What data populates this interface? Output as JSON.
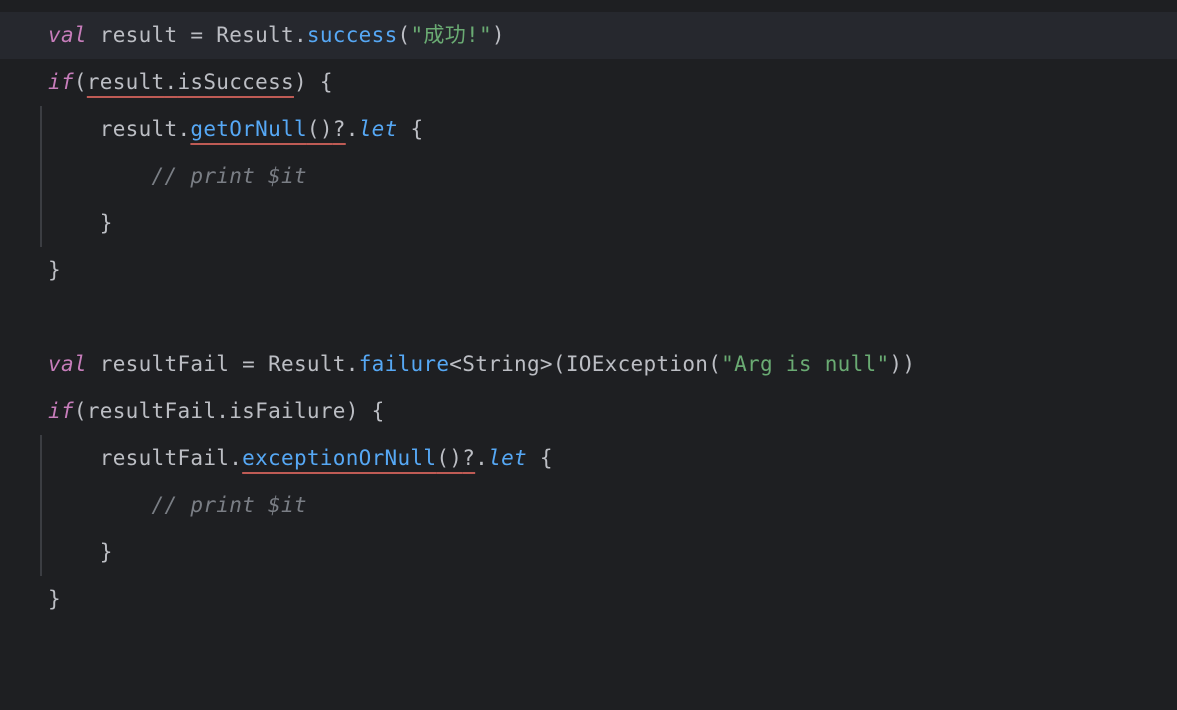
{
  "code": {
    "lines": [
      {
        "highlight": true,
        "indent": 0,
        "segments": [
          {
            "cls": "kw",
            "text": "val"
          },
          {
            "cls": "ident",
            "text": " result "
          },
          {
            "cls": "op",
            "text": "="
          },
          {
            "cls": "ident",
            "text": " Result"
          },
          {
            "cls": "op",
            "text": "."
          },
          {
            "cls": "method",
            "text": "success"
          },
          {
            "cls": "paren",
            "text": "("
          },
          {
            "cls": "str",
            "text": "\"成功!\""
          },
          {
            "cls": "paren",
            "text": ")"
          }
        ]
      },
      {
        "indent": 0,
        "segments": [
          {
            "cls": "kw",
            "text": "if"
          },
          {
            "cls": "paren",
            "text": "("
          },
          {
            "cls": "ident underline-red",
            "text": "result"
          },
          {
            "cls": "op underline-red",
            "text": "."
          },
          {
            "cls": "ident underline-red",
            "text": "isSuccess"
          },
          {
            "cls": "paren",
            "text": ")"
          },
          {
            "cls": "ident",
            "text": " "
          },
          {
            "cls": "brace",
            "text": "{"
          }
        ]
      },
      {
        "indent": 1,
        "gutter": true,
        "segments": [
          {
            "cls": "ident",
            "text": "result"
          },
          {
            "cls": "op",
            "text": "."
          },
          {
            "cls": "method underline-red",
            "text": "getOrNull"
          },
          {
            "cls": "paren underline-red",
            "text": "()"
          },
          {
            "cls": "op underline-red",
            "text": "?"
          },
          {
            "cls": "op",
            "text": "."
          },
          {
            "cls": "letkw",
            "text": "let"
          },
          {
            "cls": "ident",
            "text": " "
          },
          {
            "cls": "brace",
            "text": "{"
          }
        ]
      },
      {
        "indent": 2,
        "gutter": true,
        "segments": [
          {
            "cls": "comment",
            "text": "// print $it"
          }
        ]
      },
      {
        "indent": 1,
        "gutter": true,
        "segments": [
          {
            "cls": "brace",
            "text": "}"
          }
        ]
      },
      {
        "indent": 0,
        "segments": [
          {
            "cls": "brace",
            "text": "}"
          }
        ]
      },
      {
        "blank": true
      },
      {
        "indent": 0,
        "segments": [
          {
            "cls": "kw",
            "text": "val"
          },
          {
            "cls": "ident",
            "text": " resultFail "
          },
          {
            "cls": "op",
            "text": "="
          },
          {
            "cls": "ident",
            "text": " Result"
          },
          {
            "cls": "op",
            "text": "."
          },
          {
            "cls": "method",
            "text": "failure"
          },
          {
            "cls": "op",
            "text": "<"
          },
          {
            "cls": "type",
            "text": "String"
          },
          {
            "cls": "op",
            "text": ">"
          },
          {
            "cls": "paren",
            "text": "("
          },
          {
            "cls": "ident",
            "text": "IOException"
          },
          {
            "cls": "paren",
            "text": "("
          },
          {
            "cls": "str",
            "text": "\"Arg is null\""
          },
          {
            "cls": "paren",
            "text": "))"
          }
        ]
      },
      {
        "indent": 0,
        "segments": [
          {
            "cls": "kw",
            "text": "if"
          },
          {
            "cls": "paren",
            "text": "("
          },
          {
            "cls": "ident",
            "text": "resultFail"
          },
          {
            "cls": "op",
            "text": "."
          },
          {
            "cls": "ident",
            "text": "isFailure"
          },
          {
            "cls": "paren",
            "text": ")"
          },
          {
            "cls": "ident",
            "text": " "
          },
          {
            "cls": "brace",
            "text": "{"
          }
        ]
      },
      {
        "indent": 1,
        "gutter": true,
        "segments": [
          {
            "cls": "ident",
            "text": "resultFail"
          },
          {
            "cls": "op",
            "text": "."
          },
          {
            "cls": "method underline-red",
            "text": "exceptionOrNull"
          },
          {
            "cls": "paren underline-red",
            "text": "()"
          },
          {
            "cls": "op underline-red",
            "text": "?"
          },
          {
            "cls": "op",
            "text": "."
          },
          {
            "cls": "letkw",
            "text": "let"
          },
          {
            "cls": "ident",
            "text": " "
          },
          {
            "cls": "brace",
            "text": "{"
          }
        ]
      },
      {
        "indent": 2,
        "gutter": true,
        "segments": [
          {
            "cls": "comment",
            "text": "// print $it"
          }
        ]
      },
      {
        "indent": 1,
        "gutter": true,
        "segments": [
          {
            "cls": "brace",
            "text": "}"
          }
        ]
      },
      {
        "indent": 0,
        "segments": [
          {
            "cls": "brace",
            "text": "}"
          }
        ]
      }
    ]
  }
}
